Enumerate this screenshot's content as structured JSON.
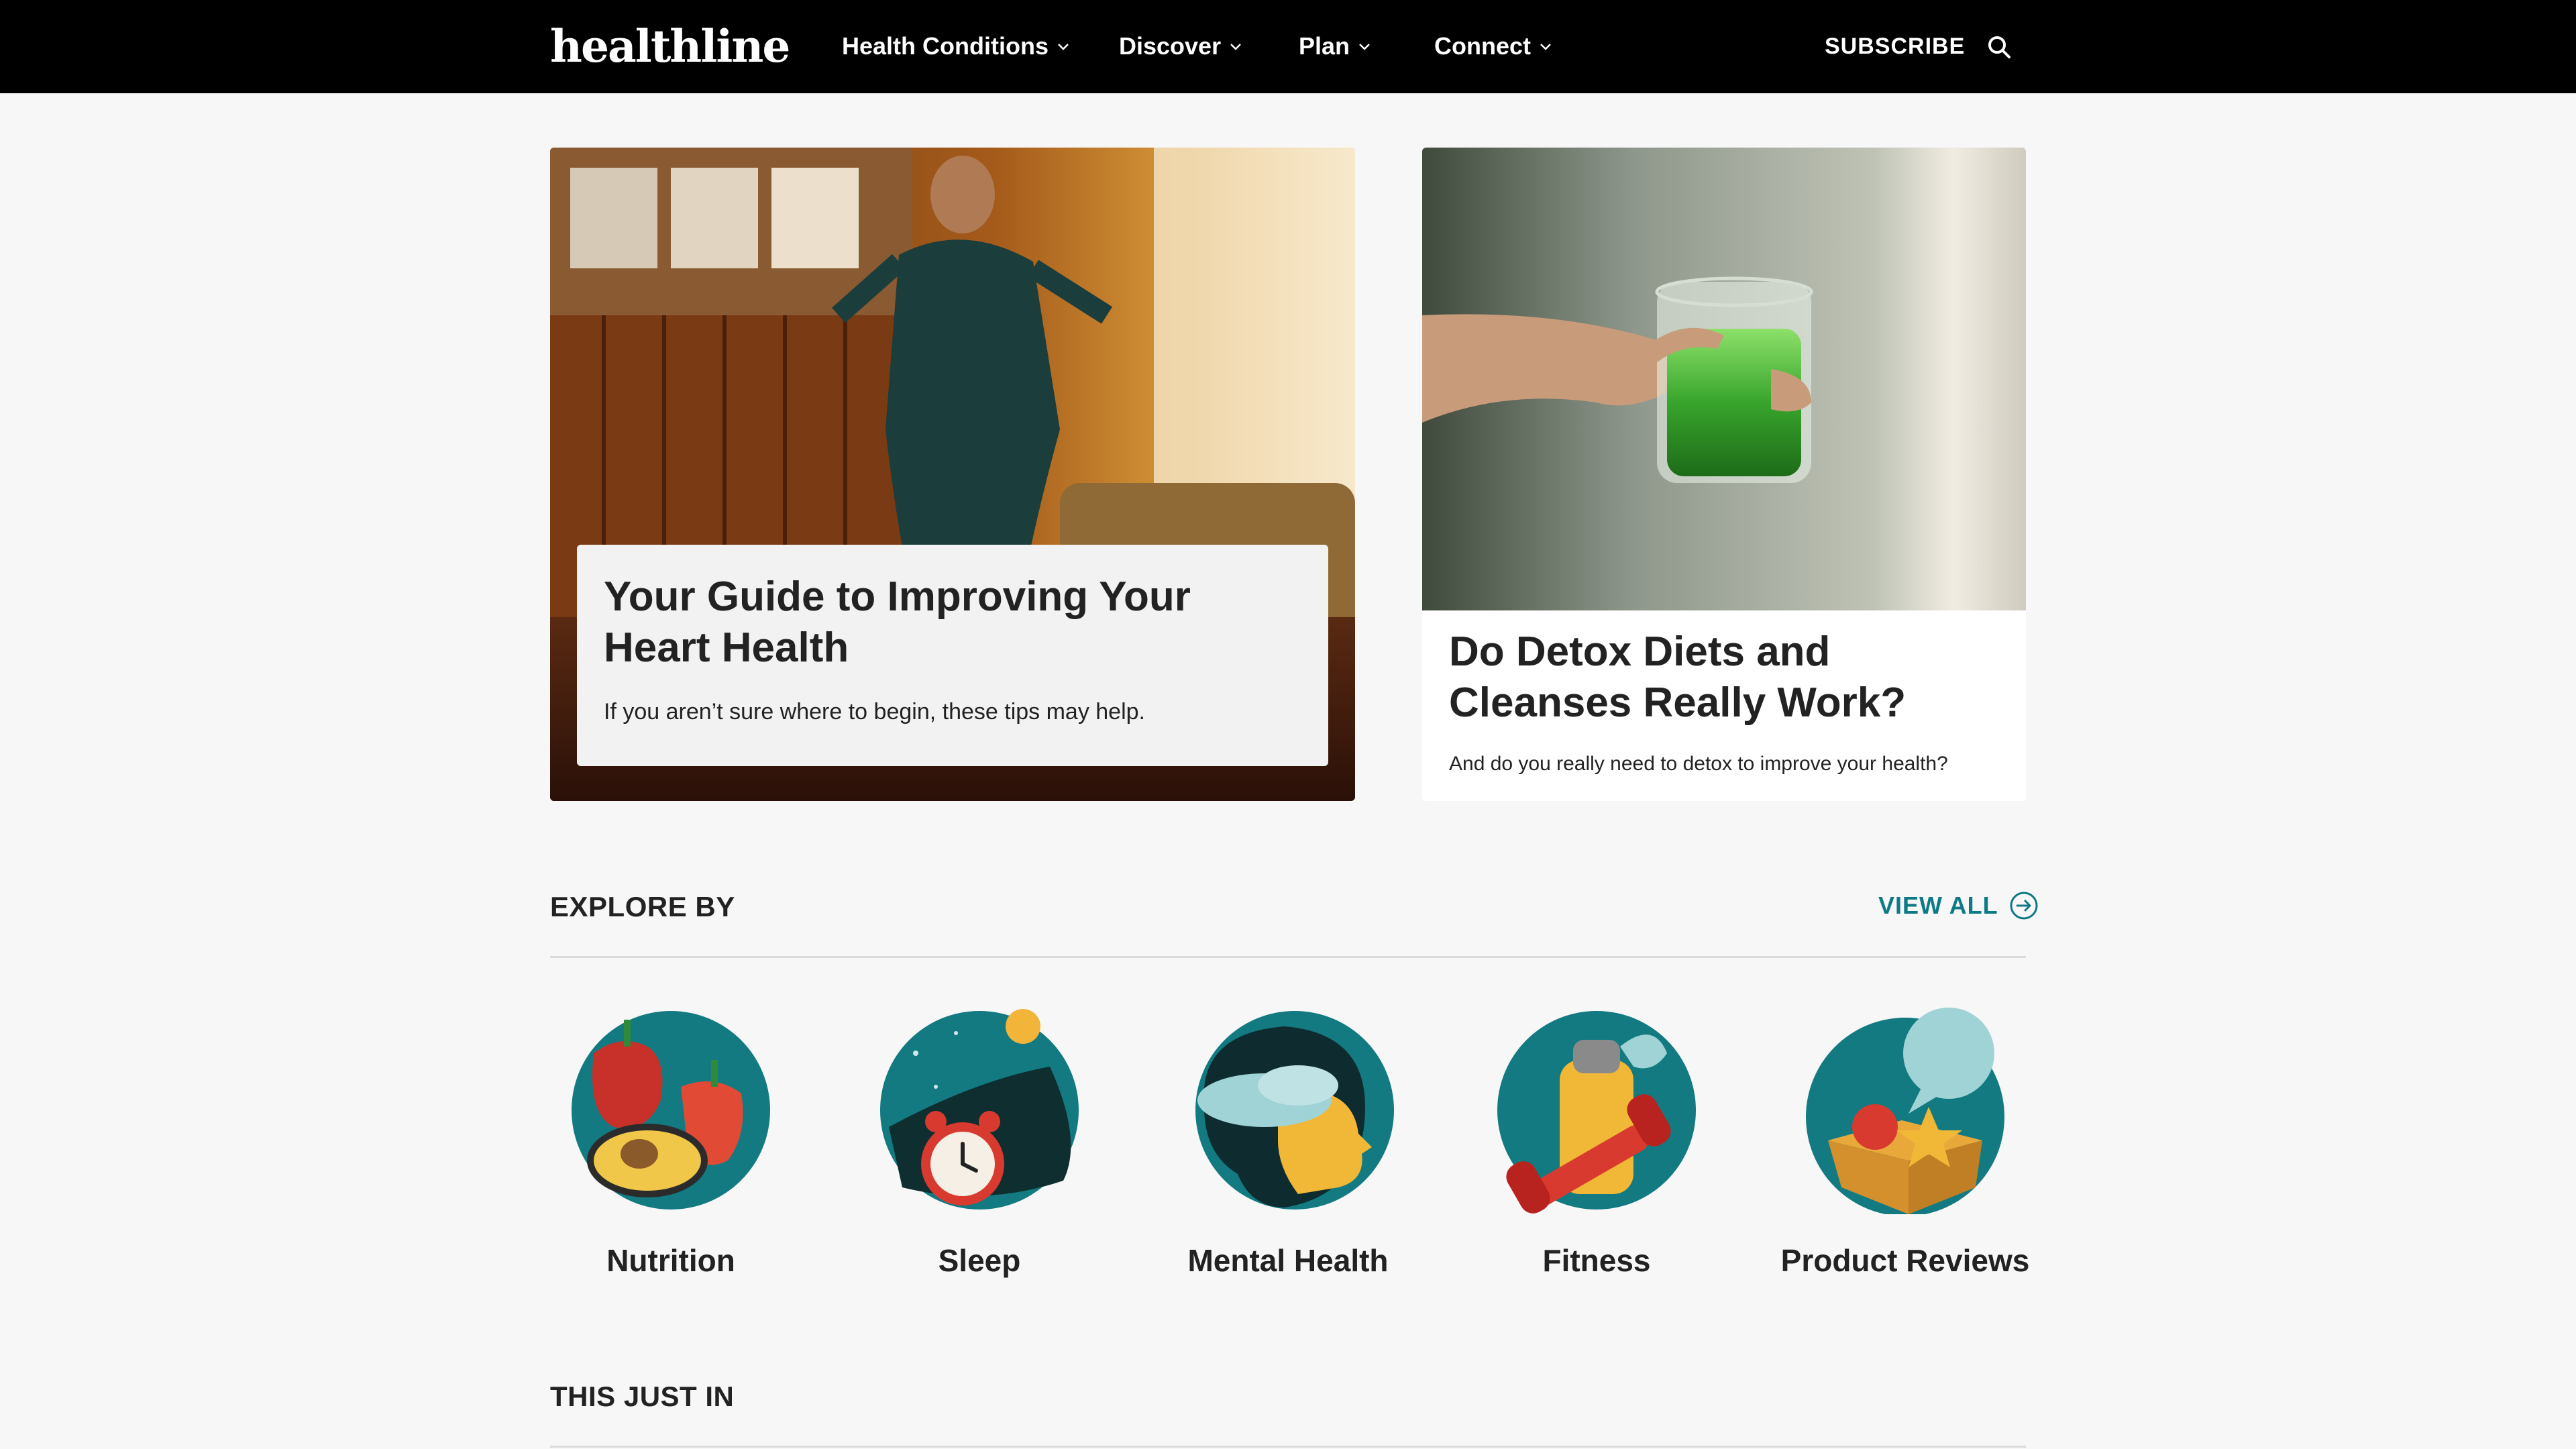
{
  "brand": {
    "logo": "healthline"
  },
  "nav": {
    "items": [
      {
        "label": "Health Conditions"
      },
      {
        "label": "Discover"
      },
      {
        "label": "Plan"
      },
      {
        "label": "Connect"
      }
    ],
    "subscribe": "SUBSCRIBE",
    "search_icon": "search-icon"
  },
  "hero": {
    "main": {
      "title": "Your Guide to Improving Your Heart Health",
      "description": "If you aren’t sure where to begin, these tips may help."
    },
    "side": {
      "title": "Do Detox Diets and Cleanses Really Work?",
      "description": "And do you really need to detox to improve your health?"
    }
  },
  "explore": {
    "heading": "EXPLORE BY",
    "view_all": "VIEW ALL",
    "categories": [
      {
        "label": "Nutrition",
        "icon": "nutrition-icon"
      },
      {
        "label": "Sleep",
        "icon": "sleep-icon"
      },
      {
        "label": "Mental Health",
        "icon": "mental-health-icon"
      },
      {
        "label": "Fitness",
        "icon": "fitness-icon"
      },
      {
        "label": "Product Reviews",
        "icon": "product-reviews-icon"
      }
    ]
  },
  "just_in": {
    "heading": "THIS JUST IN"
  },
  "colors": {
    "nav_bg": "#000000",
    "accent": "#0d7a85",
    "page_bg": "#f7f7f7",
    "icon_teal": "#137a82"
  }
}
